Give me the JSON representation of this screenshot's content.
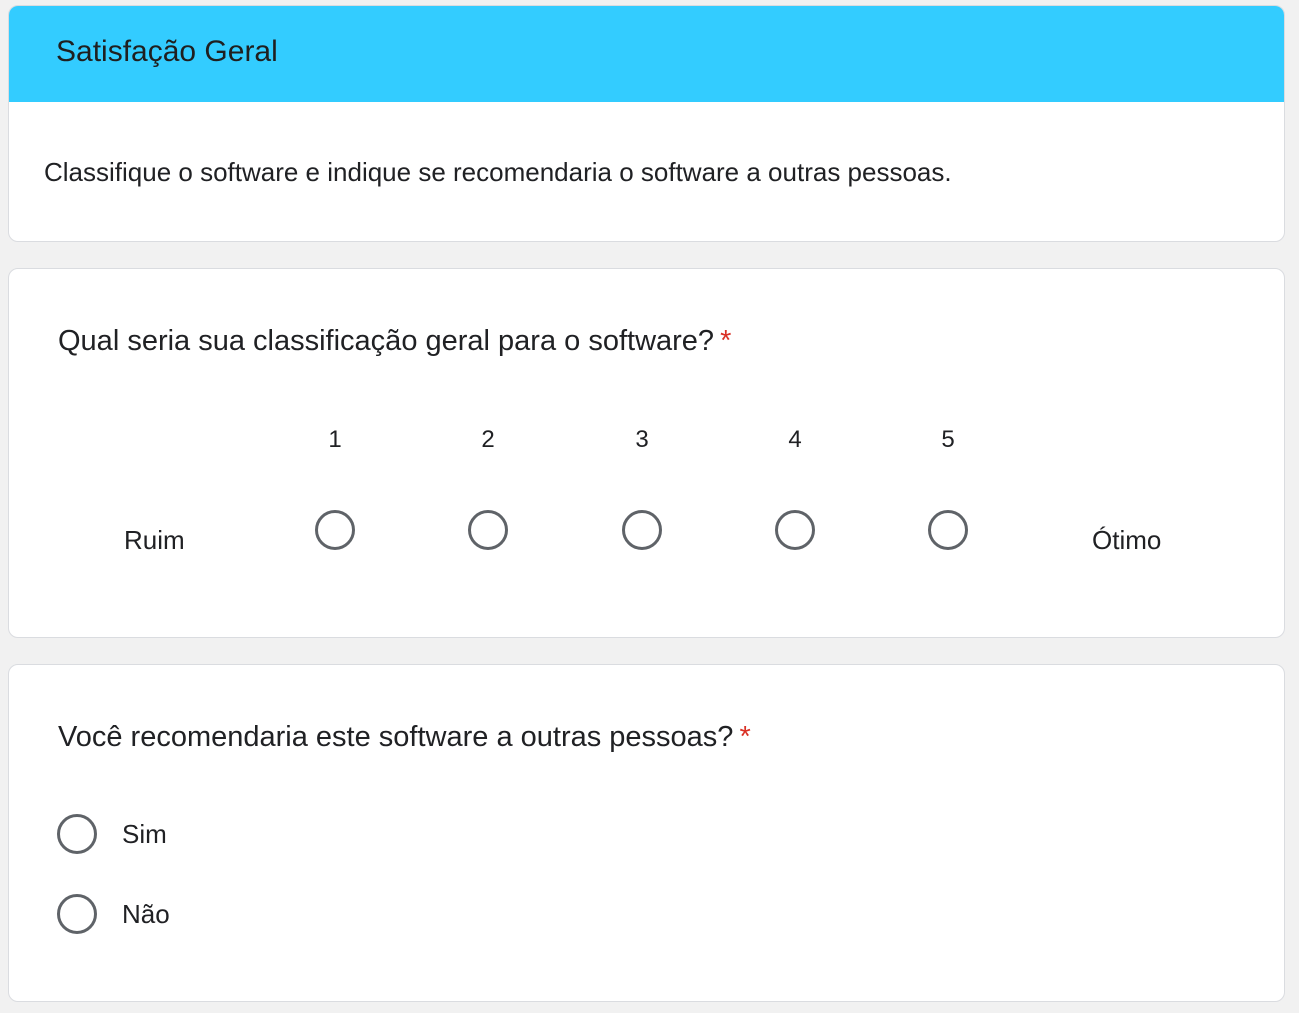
{
  "section": {
    "title": "Satisfação Geral",
    "description": "Classifique o software e indique se recomendaria o software a outras pessoas.",
    "header_color": "#33ccff"
  },
  "rating_question": {
    "title": "Qual seria sua classificação geral para o software?",
    "required_marker": "*",
    "low_label": "Ruim",
    "high_label": "Ótimo",
    "scale": [
      "1",
      "2",
      "3",
      "4",
      "5"
    ],
    "selected": null
  },
  "recommend_question": {
    "title": "Você recomendaria este software a outras pessoas?",
    "required_marker": "*",
    "options": [
      "Sim",
      "Não"
    ],
    "selected": null
  },
  "colors": {
    "required": "#d93025",
    "radio_border": "#5f6368",
    "background": "#f1f1f1"
  }
}
